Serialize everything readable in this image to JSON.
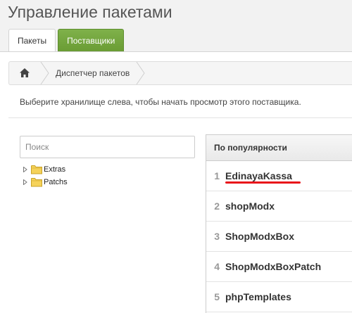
{
  "page": {
    "title": "Управление пакетами"
  },
  "tabs": [
    {
      "label": "Пакеты",
      "active": true
    },
    {
      "label": "Поставщики",
      "active": false
    }
  ],
  "breadcrumb": {
    "home_icon": "home-icon",
    "item": "Диспетчер пакетов"
  },
  "description": "Выберите хранилище слева, чтобы начать просмотр этого поставщика.",
  "search": {
    "placeholder": "Поиск",
    "value": ""
  },
  "tree": [
    {
      "label": "Extras",
      "icon": "folder-icon"
    },
    {
      "label": "Patchs",
      "icon": "folder-icon"
    }
  ],
  "popular": {
    "header": "По популярности",
    "items": [
      {
        "num": "1",
        "name": "EdinayaKassa",
        "highlighted": true
      },
      {
        "num": "2",
        "name": "shopModx"
      },
      {
        "num": "3",
        "name": "ShopModxBox"
      },
      {
        "num": "4",
        "name": "ShopModxBoxPatch"
      },
      {
        "num": "5",
        "name": "phpTemplates"
      }
    ]
  },
  "colors": {
    "tab_green": "#6a9c34",
    "highlight_underline": "#e8121a"
  }
}
